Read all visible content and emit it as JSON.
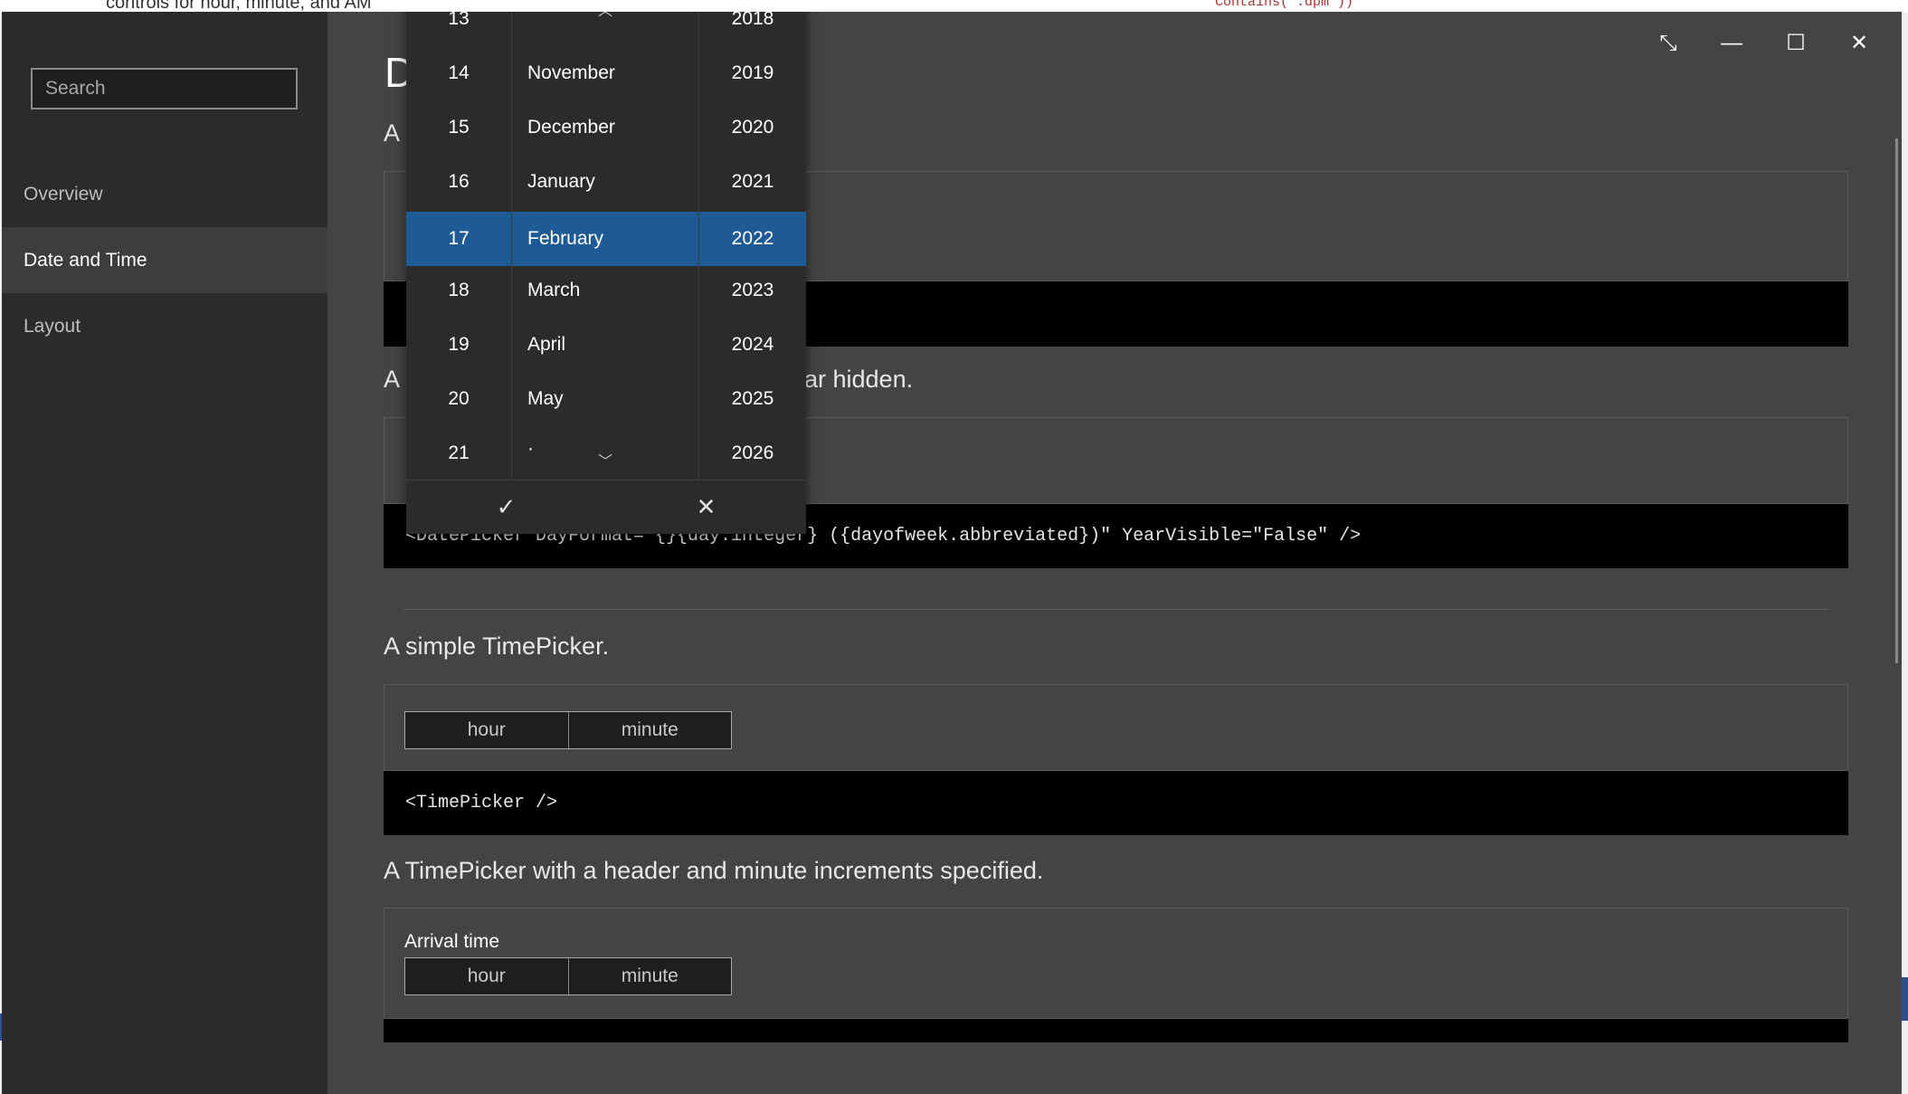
{
  "background": {
    "text": "controls for hour, minute, and AM",
    "code": "Contains(\".dpm\"))"
  },
  "sidebar": {
    "search_placeholder": "Search",
    "items": [
      {
        "label": "Overview"
      },
      {
        "label": "Date and Time"
      },
      {
        "label": "Layout"
      }
    ]
  },
  "title_buttons": {
    "collapse": "⤡",
    "minimize": "—",
    "maximize": "☐",
    "close": "✕"
  },
  "content": {
    "heading_initial": "D",
    "sections": [
      {
        "description_visible": "A"
      },
      {
        "description_left": "A",
        "description_right": "ar hidden.",
        "code": "<DatePicker DayFormat=\"{}{day.integer} ({dayofweek.abbreviated})\" YearVisible=\"False\" />"
      },
      {
        "description": "A simple TimePicker.",
        "picker": {
          "hour": "hour",
          "minute": "minute"
        },
        "code": "<TimePicker />"
      },
      {
        "description": "A TimePicker with a header and minute increments specified.",
        "header": "Arrival time",
        "picker": {
          "hour": "hour",
          "minute": "minute"
        }
      }
    ]
  },
  "flyout": {
    "days": [
      "13",
      "14",
      "15",
      "16",
      "17",
      "18",
      "19",
      "20",
      "21"
    ],
    "months": [
      "",
      "November",
      "December",
      "January",
      "February",
      "March",
      "April",
      "May",
      "·"
    ],
    "years": [
      "2018",
      "2019",
      "2020",
      "2021",
      "2022",
      "2023",
      "2024",
      "2025",
      "2026"
    ],
    "selected": {
      "day": "17",
      "month": "February",
      "year": "2022"
    },
    "up_arrow": "︿",
    "down_arrow": "﹀",
    "accept": "✓",
    "dismiss": "✕"
  },
  "colors": {
    "accent": "#1e5a96",
    "window_bg": "#444444",
    "sidebar_bg": "#2b2b2b"
  }
}
